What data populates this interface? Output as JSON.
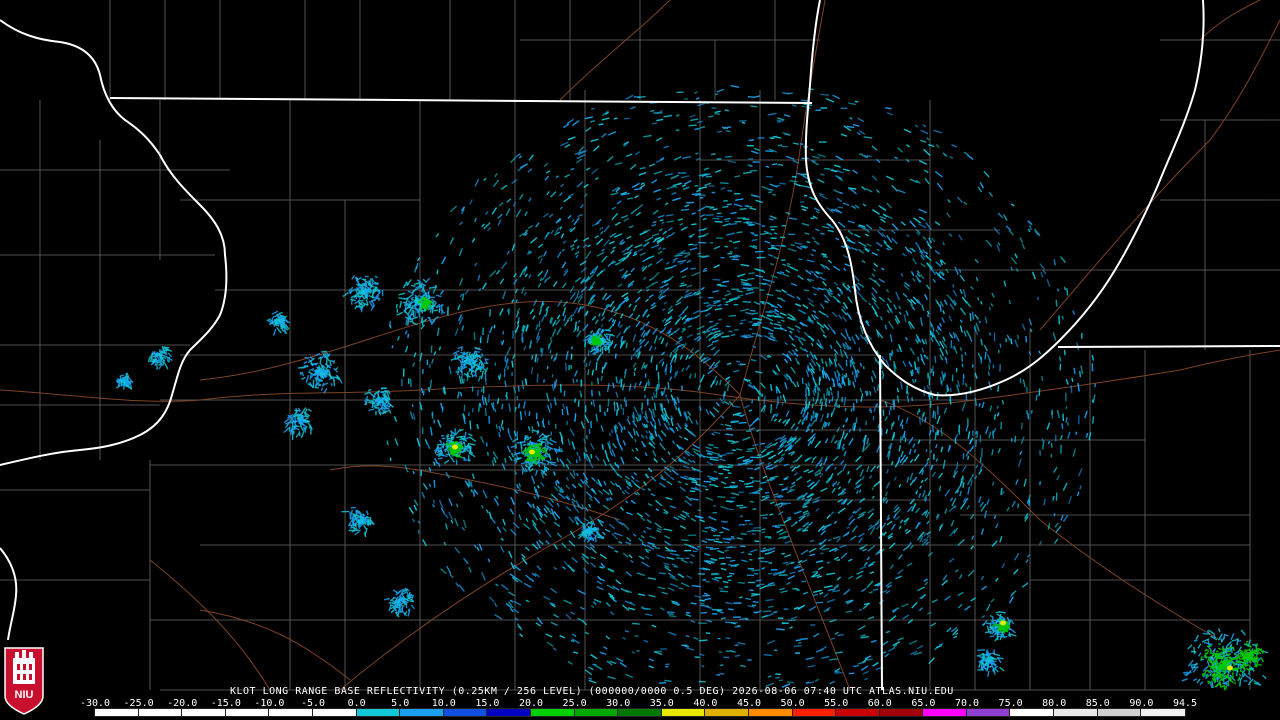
{
  "product": {
    "caption": "KLOT LONG RANGE BASE REFLECTIVITY (0.25KM / 256 LEVEL) (000000/0000 0.5 DEG) 2026-08-06 07:40 UTC  ATLAS.NIU.EDU"
  },
  "logo": {
    "text": "NIU",
    "icon": "niu-seal-icon"
  },
  "scale": {
    "labels": [
      "-30.0",
      "-25.0",
      "-20.0",
      "-15.0",
      "-10.0",
      "-5.0",
      "0.0",
      "5.0",
      "10.0",
      "15.0",
      "20.0",
      "25.0",
      "30.0",
      "35.0",
      "40.0",
      "45.0",
      "50.0",
      "55.0",
      "60.0",
      "65.0",
      "70.0",
      "75.0",
      "80.0",
      "85.0",
      "90.0",
      "94.5"
    ],
    "colors": [
      "#000000",
      "#000000",
      "#000000",
      "#000000",
      "#000000",
      "#000000",
      "#10c8d8",
      "#1aa0f0",
      "#1050e0",
      "#0000c0",
      "#00d000",
      "#00a800",
      "#007800",
      "#e8e800",
      "#e0b000",
      "#ff8c00",
      "#ff2000",
      "#c80000",
      "#a00000",
      "#ff00ff",
      "#9040d0",
      "#ffffff",
      "#e8e8e8",
      "#d0d0d0",
      "#f0f0f0"
    ]
  },
  "colors": {
    "background": "#000000",
    "state_border": "#ffffff",
    "county_border": "#8a8a8a",
    "road": "#8b4a2a",
    "echo_light": "#10c8d8",
    "echo_medium": "#1aa0f0",
    "echo_strong": "#00c800",
    "echo_heavy": "#e8e800"
  }
}
